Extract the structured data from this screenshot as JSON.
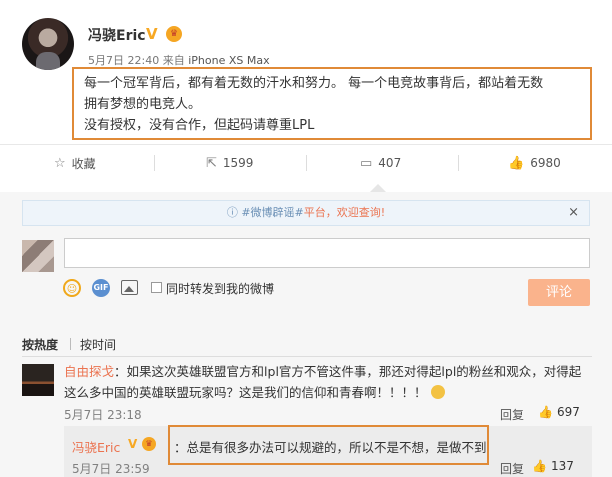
{
  "post": {
    "username": "冯骁Eric",
    "verified_badge": "V",
    "crown_icon": "crown-icon",
    "time": "5月7日 22:40",
    "source_prefix": "来自",
    "device": "iPhone XS Max",
    "lines": [
      "每一个冠军背后，都有着无数的汗水和努力。 每一个电竞故事背后，都站着无数",
      "拥有梦想的电竞人。",
      "没有授权，没有合作，但起码请尊重LPL"
    ],
    "highlight_color": "#e08a37"
  },
  "actions": {
    "favorite": {
      "icon": "star-icon",
      "label": "收藏"
    },
    "repost": {
      "icon": "share-icon",
      "count": "1599"
    },
    "comment": {
      "icon": "comment-icon",
      "count": "407"
    },
    "like": {
      "icon": "thumbs-up-icon",
      "count": "6980"
    }
  },
  "notice": {
    "icon": "info-icon",
    "hashtag": "#微博辟谣#",
    "text": "平台，欢迎查询!",
    "close": "×"
  },
  "composer": {
    "placeholder": "",
    "tools": [
      "emoji-icon",
      "gif-icon",
      "image-icon"
    ],
    "repost_checkbox_label": "同时转发到我的微博",
    "submit_label": "评论"
  },
  "sort": {
    "hot": "按热度",
    "time": "按时间"
  },
  "comment": {
    "username": "自由探戈",
    "separator": "：",
    "text_line1": "如果这次英雄联盟官方和lpl官方不管这件事，那还对得起lpl的粉丝和观众，对得起",
    "text_line2": "这么多中国的英雄联盟玩家吗？这是我们的信仰和青春啊！！！！",
    "emoji": "crying-emoji",
    "time": "5月7日 23:18",
    "reply_label": "回复",
    "like_count": "697"
  },
  "sub_reply": {
    "username": "冯骁Eric",
    "verified_badge": "V",
    "separator": "：",
    "text": "总是有很多办法可以规避的，所以不是不想，是做不到",
    "time": "5月7日 23:59",
    "reply_label": "回复",
    "like_count": "137"
  }
}
